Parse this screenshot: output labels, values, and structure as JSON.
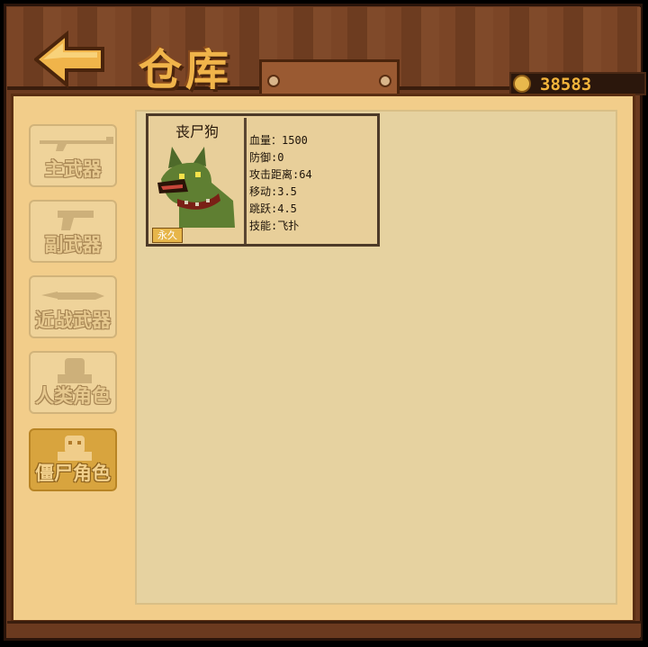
{
  "header": {
    "title": "仓库",
    "coins": "38583"
  },
  "sidebar": {
    "items": [
      {
        "label": "主武器",
        "icon": "rifle-icon"
      },
      {
        "label": "副武器",
        "icon": "pistol-icon"
      },
      {
        "label": "近战武器",
        "icon": "knife-icon"
      },
      {
        "label": "人类角色",
        "icon": "human-icon"
      },
      {
        "label": "僵尸角色",
        "icon": "zombie-icon",
        "active": true
      }
    ]
  },
  "item": {
    "name": "丧尸狗",
    "badge": "永久",
    "stats": [
      "血量：1500",
      "防御:0",
      "攻击距离:64",
      "移动:3.5",
      "跳跃:4.5",
      "技能:飞扑"
    ]
  },
  "colors": {
    "wood": "#6b3a1f",
    "panel": "#f2cd8a",
    "gold": "#f3b43b",
    "active": "#d8a43e"
  }
}
